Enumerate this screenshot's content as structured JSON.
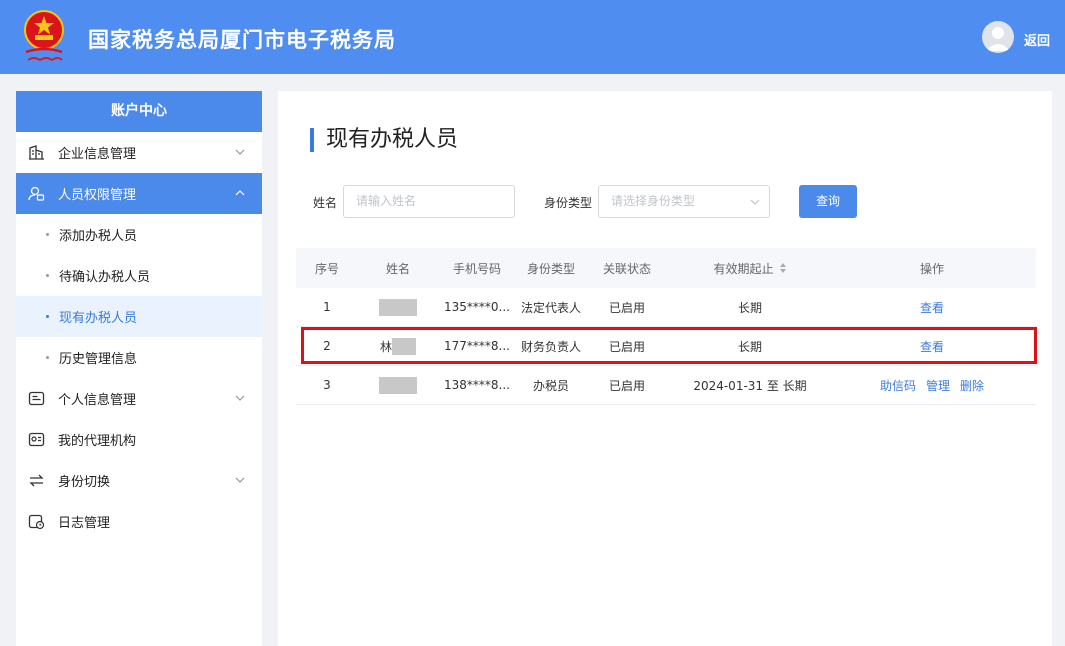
{
  "header": {
    "site_title": "国家税务总局厦门市电子税务局",
    "back_label": "返回"
  },
  "sidebar": {
    "title": "账户中心",
    "items": [
      {
        "label": "企业信息管理",
        "icon": "building-icon",
        "expandable": true
      },
      {
        "label": "人员权限管理",
        "icon": "user-lock-icon",
        "expandable": true,
        "active": true
      },
      {
        "label": "个人信息管理",
        "icon": "id-card-icon",
        "expandable": true
      },
      {
        "label": "我的代理机构",
        "icon": "agency-icon",
        "expandable": false
      },
      {
        "label": "身份切换",
        "icon": "switch-icon",
        "expandable": true
      },
      {
        "label": "日志管理",
        "icon": "log-icon",
        "expandable": false
      }
    ],
    "sub_items": [
      {
        "label": "添加办税人员"
      },
      {
        "label": "待确认办税人员"
      },
      {
        "label": "现有办税人员",
        "current": true
      },
      {
        "label": "历史管理信息"
      }
    ]
  },
  "main": {
    "page_title": "现有办税人员",
    "filters": {
      "name_label": "姓名",
      "name_placeholder": "请输入姓名",
      "type_label": "身份类型",
      "type_placeholder": "请选择身份类型",
      "query_button": "查询"
    },
    "table": {
      "columns": [
        "序号",
        "姓名",
        "手机号码",
        "身份类型",
        "关联状态",
        "有效期起止",
        "操作"
      ],
      "rows": [
        {
          "index": "1",
          "name": "",
          "phone": "135****0...",
          "identity": "法定代表人",
          "status": "已启用",
          "validity": "长期",
          "actions": [
            "查看"
          ]
        },
        {
          "index": "2",
          "name": "林",
          "phone": "177****8...",
          "identity": "财务负责人",
          "status": "已启用",
          "validity": "长期",
          "actions": [
            "查看"
          ]
        },
        {
          "index": "3",
          "name": "",
          "phone": "138****8...",
          "identity": "办税员",
          "status": "已启用",
          "validity": "2024-01-31 至 长期",
          "actions": [
            "助信码",
            "管理",
            "删除"
          ]
        }
      ]
    }
  },
  "colors": {
    "header_bg": "#4f8ef0",
    "accent": "#4b89ea",
    "link": "#3a7be0",
    "highlight_border": "#e0101a"
  }
}
